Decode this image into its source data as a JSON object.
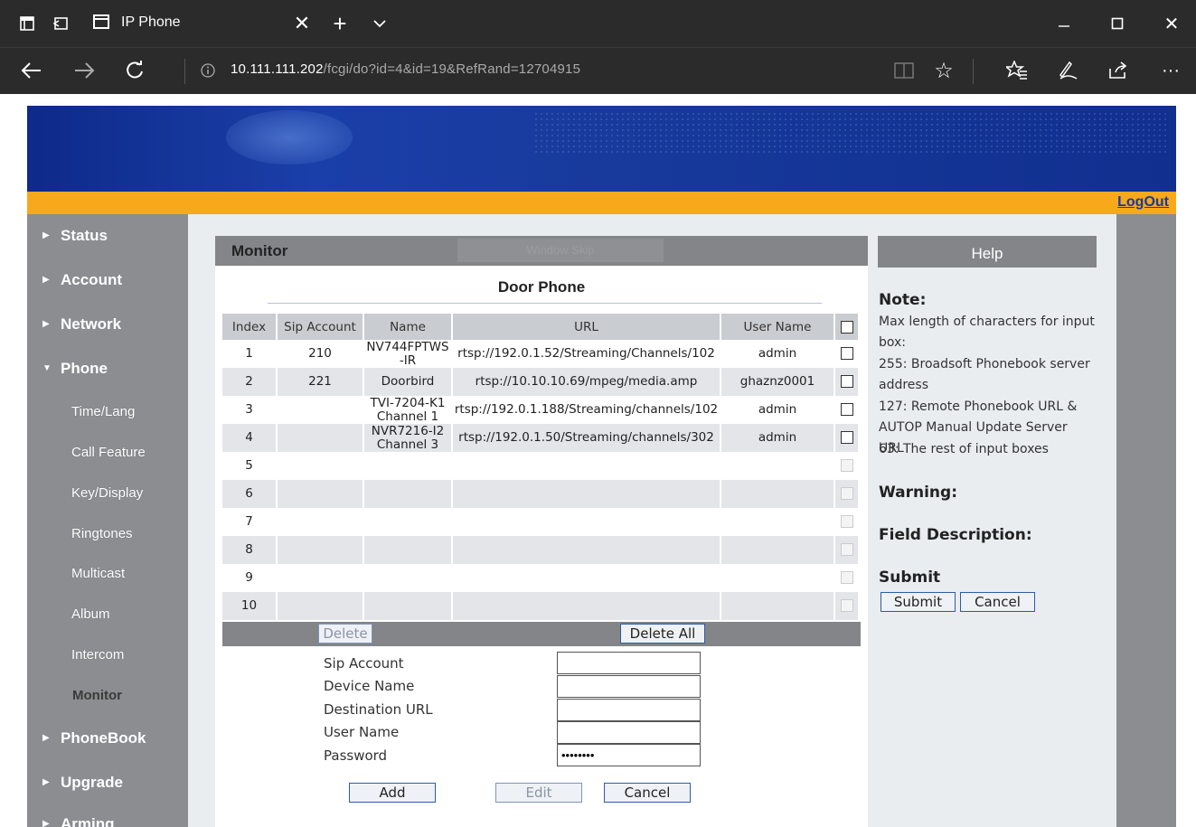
{
  "browser": {
    "tab_title": "IP Phone",
    "url_host": "10.111.111.202",
    "url_path": "/fcgi/do?id=4&id=19&RefRand=12704915",
    "icons": [
      "tab-list-icon",
      "tab-back-icon",
      "page-icon",
      "close-icon",
      "plus-icon",
      "chevron-down-icon",
      "minimize-icon",
      "maximize-icon",
      "close-window-icon",
      "back-arrow-icon",
      "forward-arrow-icon",
      "refresh-icon",
      "info-icon",
      "reading-view-icon",
      "favorite-star-icon",
      "favorites-list-icon",
      "pen-icon",
      "share-icon",
      "more-icon"
    ]
  },
  "header": {
    "logout": "LogOut"
  },
  "sidebar": {
    "items": [
      {
        "label": "Status",
        "arrow": "▶"
      },
      {
        "label": "Account",
        "arrow": "▶"
      },
      {
        "label": "Network",
        "arrow": "▶"
      },
      {
        "label": "Phone",
        "arrow": "▼"
      },
      {
        "label": "PhoneBook",
        "arrow": "▶"
      },
      {
        "label": "Upgrade",
        "arrow": "▶"
      },
      {
        "label": "Arming",
        "arrow": "▶"
      }
    ],
    "sub_items": [
      "Time/Lang",
      "Call Feature",
      "Key/Display",
      "Ringtones",
      "Multicast",
      "Album",
      "Intercom",
      "Monitor"
    ]
  },
  "monitor": {
    "title": "Monitor",
    "ghost": "Window Skip",
    "section_title": "Door Phone",
    "columns": [
      "Index",
      "Sip Account",
      "Name",
      "URL",
      "User Name"
    ],
    "rows": [
      {
        "index": "1",
        "sip": "210",
        "name": "NV744FPTWS-IR",
        "url": "rtsp://192.0.1.52/Streaming/Channels/102",
        "user": "admin"
      },
      {
        "index": "2",
        "sip": "221",
        "name": "Doorbird",
        "url": "rtsp://10.10.10.69/mpeg/media.amp",
        "user": "ghaznz0001"
      },
      {
        "index": "3",
        "sip": "",
        "name": "TVI-7204-K1 Channel 1",
        "url": "rtsp://192.0.1.188/Streaming/channels/102",
        "user": "admin"
      },
      {
        "index": "4",
        "sip": "",
        "name": "NVR7216-I2 Channel 3",
        "url": "rtsp://192.0.1.50/Streaming/channels/302",
        "user": "admin"
      },
      {
        "index": "5",
        "sip": "",
        "name": "",
        "url": "",
        "user": ""
      },
      {
        "index": "6",
        "sip": "",
        "name": "",
        "url": "",
        "user": ""
      },
      {
        "index": "7",
        "sip": "",
        "name": "",
        "url": "",
        "user": ""
      },
      {
        "index": "8",
        "sip": "",
        "name": "",
        "url": "",
        "user": ""
      },
      {
        "index": "9",
        "sip": "",
        "name": "",
        "url": "",
        "user": ""
      },
      {
        "index": "10",
        "sip": "",
        "name": "",
        "url": "",
        "user": ""
      }
    ],
    "delete": "Delete",
    "delete_all": "Delete All",
    "form": {
      "sip_account": "Sip Account",
      "device_name": "Device Name",
      "destination_url": "Destination URL",
      "user_name": "User Name",
      "password": "Password",
      "password_value": "••••••••"
    },
    "add": "Add",
    "edit": "Edit",
    "cancel": "Cancel"
  },
  "help": {
    "title": "Help",
    "note_title": "Note:",
    "note_lines": [
      "Max length of characters for input box:",
      "255: Broadsoft Phonebook server address",
      "127: Remote Phonebook URL & AUTOP Manual Update Server URL",
      "63: The rest of input boxes"
    ],
    "warning": "Warning:",
    "field_description": "Field Description:",
    "submit_title": "Submit",
    "submit": "Submit",
    "cancel": "Cancel"
  },
  "colors": {
    "sidebar": "#8b8d91",
    "banner": "#173a9c",
    "orange": "#f7a81b",
    "content_bg": "#e9edf0",
    "chrome": "#2b2b2b"
  }
}
